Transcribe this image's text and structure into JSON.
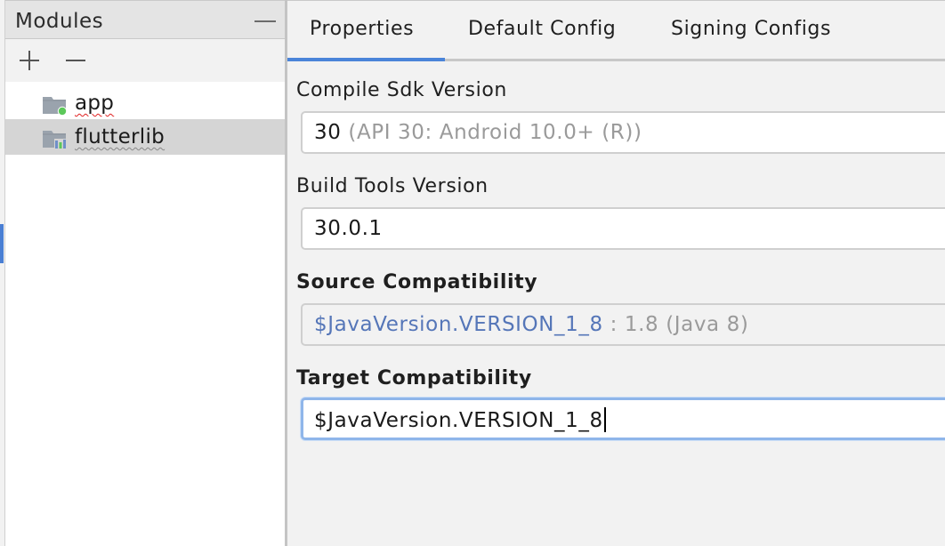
{
  "modules_panel": {
    "title": "Modules",
    "collapse_icon": "minimize-icon",
    "toolbar": {
      "add_icon": "plus-icon",
      "remove_icon": "minus-icon"
    },
    "items": [
      {
        "label": "app",
        "icon": "android-app-module-icon",
        "selected": false
      },
      {
        "label": "flutterlib",
        "icon": "library-module-icon",
        "selected": true
      }
    ]
  },
  "tabs": [
    {
      "label": "Properties",
      "active": true
    },
    {
      "label": "Default Config",
      "active": false
    },
    {
      "label": "Signing Configs",
      "active": false
    }
  ],
  "fields": {
    "compile_sdk": {
      "label": "Compile Sdk Version",
      "value": "30",
      "hint": "(API 30: Android 10.0+ (R))"
    },
    "build_tools": {
      "label": "Build Tools Version",
      "value": "30.0.1"
    },
    "source_compat": {
      "label": "Source Compatibility",
      "value": "$JavaVersion.VERSION_1_8",
      "hint": ": 1.8 (Java 8)"
    },
    "target_compat": {
      "label": "Target Compatibility",
      "value": "$JavaVersion.VERSION_1_8"
    }
  },
  "colors": {
    "accent": "#4a84d9",
    "reference_text": "#5576b8",
    "hint_text": "#9a9a9a",
    "focus_border": "#8fb6ea",
    "selection": "#d5d5d5"
  }
}
